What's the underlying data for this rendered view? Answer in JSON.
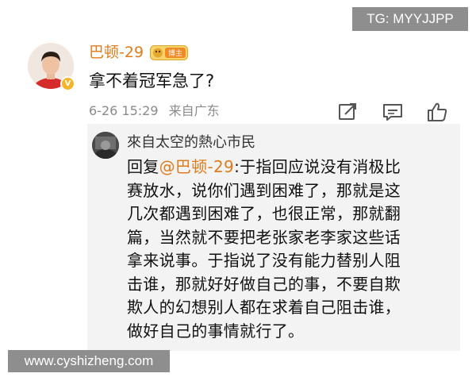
{
  "watermarks": {
    "top_right": "TG: MYYJJPP",
    "bottom_left": "www.cyshizheng.com"
  },
  "post": {
    "username": "巴顿-29",
    "badge_label": "博主",
    "text": "拿不着冠军急了?",
    "time": "6-26 15:29",
    "location": "来自广东",
    "icons": [
      "share-icon",
      "comment-icon",
      "like-icon"
    ]
  },
  "reply": {
    "username": "來自太空的熱心市民",
    "prefix": "回复",
    "mention": "@巴顿-29",
    "lines": [
      ":于指回应说没有消极比",
      "赛放水，说你们遇到困难了，那就是这",
      "几次都遇到困难了，也很正常，那就翻",
      "篇，当然就不要把老张家老李家这些话",
      "拿来说事。于指说了没有能力替别人阻",
      "击谁，那就好好做自己的事，不要自欺",
      "欺人的幻想别人都在求着自己阻击谁，",
      "做好自己的事情就行了。"
    ]
  },
  "colors": {
    "accent": "#e07b1a",
    "meta_gray": "#8a8a8a",
    "reply_bg": "#f3f3f3",
    "watermark_bg": "#8e8e8e"
  }
}
